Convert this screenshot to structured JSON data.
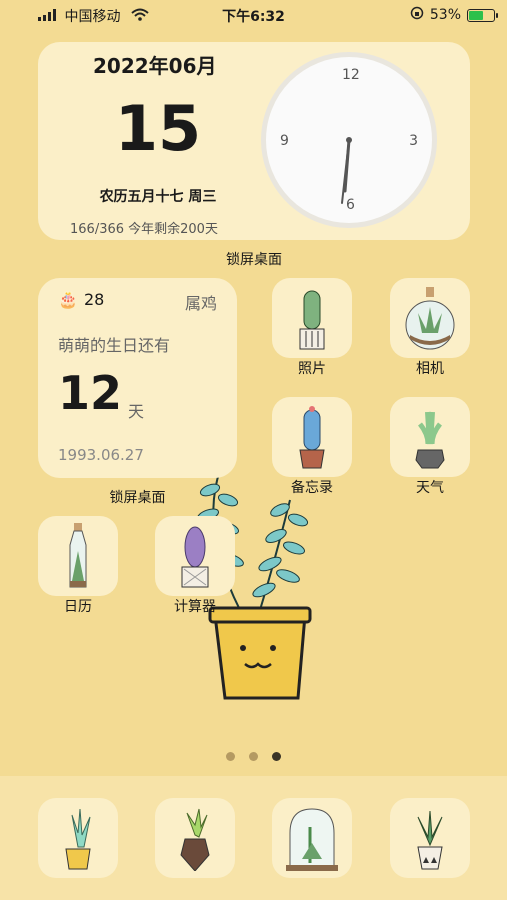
{
  "status_bar": {
    "carrier": "中国移动",
    "time": "下午6:32",
    "battery": "53%",
    "battery_level": 0.53
  },
  "date_widget": {
    "year_month": "2022年06月",
    "day": "15",
    "lunar": "农历五月十七 周三",
    "year_progress": "166/366 今年剩余200天",
    "clock": {
      "n12": "12",
      "n3": "3",
      "n6": "6",
      "n9": "9"
    }
  },
  "lock_label_1": "锁屏桌面",
  "birthday_widget": {
    "cake_count": "28",
    "zodiac": "属鸡",
    "text": "萌萌的生日还有",
    "days": "12",
    "unit": "天",
    "date": "1993.06.27"
  },
  "lock_label_2": "锁屏桌面",
  "apps": {
    "photos": "照片",
    "camera": "相机",
    "notes": "备忘录",
    "weather": "天气",
    "calendar": "日历",
    "calculator": "计算器"
  },
  "page_indicator": {
    "count": 3,
    "active": 3
  },
  "colors": {
    "background": "#F3DB93",
    "widget": "#FBEFC8",
    "cactus_green": "#7fb27f",
    "pot": "#f0c84b"
  }
}
